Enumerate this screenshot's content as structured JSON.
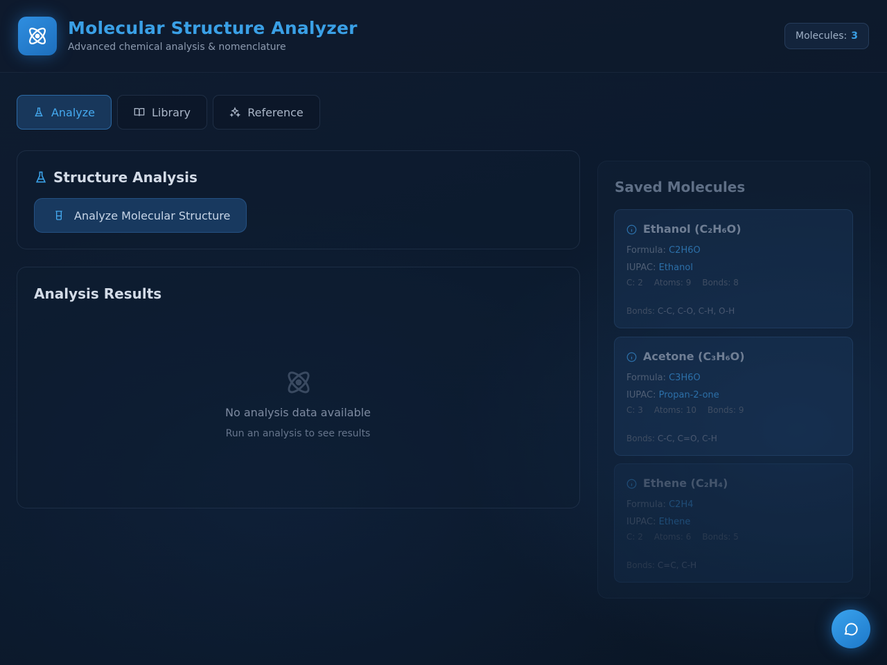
{
  "header": {
    "title": "Molecular Structure Analyzer",
    "subtitle": "Advanced chemical analysis & nomenclature",
    "count_label": "Molecules:",
    "count_value": "3",
    "logo_icon": "atom-icon"
  },
  "tabs": [
    {
      "label": "Analyze",
      "icon": "flask-icon",
      "active": true
    },
    {
      "label": "Library",
      "icon": "book-icon",
      "active": false
    },
    {
      "label": "Reference",
      "icon": "sparkles-icon",
      "active": false
    }
  ],
  "structure_panel": {
    "title": "Structure Analysis",
    "button_label": "Analyze Molecular Structure"
  },
  "results_panel": {
    "title": "Analysis Results",
    "empty_title": "No analysis data available",
    "empty_subtitle": "Run an analysis to see results"
  },
  "saved": {
    "title": "Saved Molecules",
    "molecules": [
      {
        "name": "Ethanol (C₂H₆O)",
        "formula_label": "Formula:",
        "formula": "C2H6O",
        "iupac_label": "IUPAC:",
        "iupac": "Ethanol",
        "carbons": "C: 2",
        "atoms": "Atoms: 9",
        "bond_count": "Bonds: 8",
        "bonds_label": "Bonds:",
        "bonds": "C-C, C-O, C-H, O-H"
      },
      {
        "name": "Acetone (C₃H₆O)",
        "formula_label": "Formula:",
        "formula": "C3H6O",
        "iupac_label": "IUPAC:",
        "iupac": "Propan-2-one",
        "carbons": "C: 3",
        "atoms": "Atoms: 10",
        "bond_count": "Bonds: 9",
        "bonds_label": "Bonds:",
        "bonds": "C-C, C=O, C-H"
      },
      {
        "name": "Ethene (C₂H₄)",
        "formula_label": "Formula:",
        "formula": "C2H4",
        "iupac_label": "IUPAC:",
        "iupac": "Ethene",
        "carbons": "C: 2",
        "atoms": "Atoms: 6",
        "bond_count": "Bonds: 5",
        "bonds_label": "Bonds:",
        "bonds": "C=C, C-H"
      }
    ]
  },
  "fab": {
    "icon": "chat-bubble-icon"
  },
  "colors": {
    "accent": "#3aa0e6",
    "background": "#0c1a2d"
  }
}
